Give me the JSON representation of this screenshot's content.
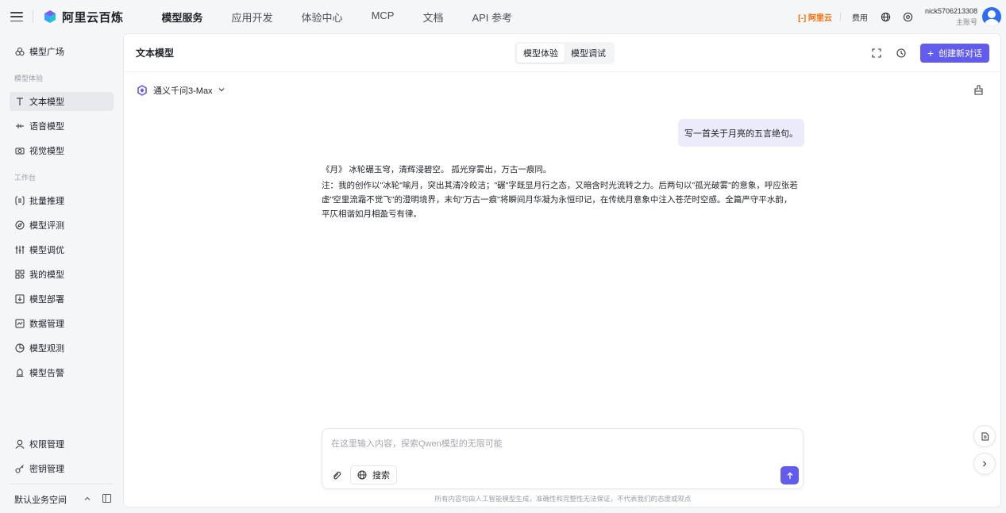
{
  "topbar": {
    "brand": "阿里云百炼",
    "nav": [
      "模型服务",
      "应用开发",
      "体验中心",
      "MCP",
      "文档",
      "API 参考"
    ],
    "active_nav": "模型服务",
    "aliyun_logo": "[-] 阿里云",
    "fee": "费用",
    "user_name": "nick5706213308",
    "user_role": "主账号",
    "accent": "#615ced",
    "aliyun_color": "#ff6a00"
  },
  "sidebar": {
    "top_item": "模型广场",
    "group1": "模型体验",
    "group1_items": [
      "文本模型",
      "语音模型",
      "视觉模型"
    ],
    "group2": "工作台",
    "group2_items": [
      "批量推理",
      "模型评测",
      "模型调优",
      "我的模型",
      "模型部署",
      "数据管理",
      "模型观测",
      "模型告警"
    ],
    "bottom_items": [
      "权限管理",
      "密钥管理"
    ],
    "workspace": "默认业务空间"
  },
  "header": {
    "title": "文本模型",
    "tabs": [
      "模型体验",
      "模型调试"
    ],
    "active_tab": "模型体验",
    "new_chat": "创建新对话"
  },
  "chat": {
    "model": "通义千问3-Max",
    "user_message": "写一首关于月亮的五言绝句。",
    "answer_line1": "《月》 冰轮碾玉穹，清辉浸碧空。 孤光穿雾出，万古一痕同。",
    "answer_line2": "注：我的创作以\"冰轮\"喻月，突出其清冷皎洁；\"碾\"字既显月行之态，又暗含时光流转之力。后两句以\"孤光破雾\"的意象，呼应张若虚\"空里流霜不觉飞\"的澄明境界，末句\"万古一痕\"将瞬间月华凝为永恒印记，在传统月意象中注入苍茫时空感。全篇严守平水韵，平仄相谐如月相盈亏有律。"
  },
  "composer": {
    "placeholder": "在这里输入内容，探索Qwen模型的无限可能",
    "search": "搜索",
    "disclaimer": "所有内容均由人工智能模型生成，准确性和完整性无法保证，不代表我们的态度或观点"
  }
}
